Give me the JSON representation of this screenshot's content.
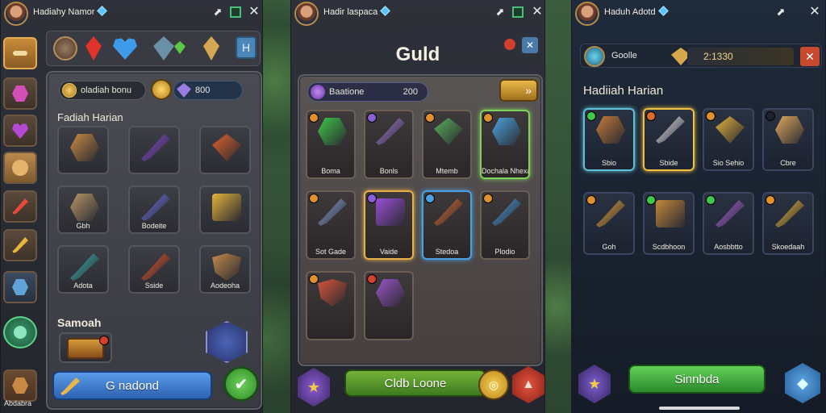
{
  "colors": {
    "accent_gold": "#e0b040",
    "accent_blue": "#3b7bd6",
    "accent_green": "#52b848",
    "danger_red": "#d4402e"
  },
  "panel1": {
    "title": "Hadiahy Namor",
    "close_icon": "close-icon",
    "resources": {
      "gold": "oladiah bonu",
      "gems": "800"
    },
    "section_daily": "Fadiah Harian",
    "items": [
      {
        "label": "",
        "icon": "amulet-icon"
      },
      {
        "label": "",
        "icon": "scroll-icon"
      },
      {
        "label": "",
        "icon": "ore-icon"
      },
      {
        "label": "Gbh",
        "icon": "helm-icon"
      },
      {
        "label": "Bodeite",
        "icon": "orb-staff-icon"
      },
      {
        "label": "",
        "icon": "gold-bars-icon"
      },
      {
        "label": "Adota",
        "icon": "dagger-icon"
      },
      {
        "label": "Sside",
        "icon": "horn-icon"
      },
      {
        "label": "Aodeoha",
        "icon": "seed-icon"
      }
    ],
    "section_extra": "Samoah",
    "main_button": "G nadond",
    "sidebar_bottom_label": "Abdabra"
  },
  "panel2": {
    "title": "Hadir laspaca",
    "heading": "Guld",
    "resources": {
      "name": "Baatione",
      "value": "200"
    },
    "items": [
      {
        "label": "Boma",
        "icon": "green-potion-icon"
      },
      {
        "label": "Bonls",
        "icon": "mace-icon"
      },
      {
        "label": "Mtemb",
        "icon": "spear-icon"
      },
      {
        "label": "Dochala Nhexabar",
        "icon": "hammer-icon"
      },
      {
        "label": "Sot Gade",
        "icon": "axe-icon"
      },
      {
        "label": "Vaide",
        "icon": "club-icon"
      },
      {
        "label": "Stedoa",
        "icon": "blue-mace-icon"
      },
      {
        "label": "Plodio",
        "icon": "red-staff-icon"
      },
      {
        "label": "",
        "icon": "purple-crate-icon"
      },
      {
        "label": "",
        "icon": "amethyst-icon"
      }
    ],
    "main_button": "Cldb Loone"
  },
  "panel3": {
    "title": "Haduh Adotd",
    "resource": {
      "name": "Goolle",
      "value": "2:1330"
    },
    "section_daily": "Hadiiah Harian",
    "items": [
      {
        "label": "Sbio",
        "icon": "sword-icon"
      },
      {
        "label": "Sbide",
        "icon": "crystal-icon"
      },
      {
        "label": "Sio Sehio",
        "icon": "gold-ore-icon"
      },
      {
        "label": "Cbre",
        "icon": "bread-icon"
      },
      {
        "label": "Goh",
        "icon": "chest-icon"
      },
      {
        "label": "Scdbhoon",
        "icon": "arrow-staff-icon"
      },
      {
        "label": "Aosbbtto",
        "icon": "potion-icon"
      },
      {
        "label": "Skoedaah",
        "icon": "gold-gem-icon"
      }
    ],
    "main_button": "Sinnbda"
  }
}
